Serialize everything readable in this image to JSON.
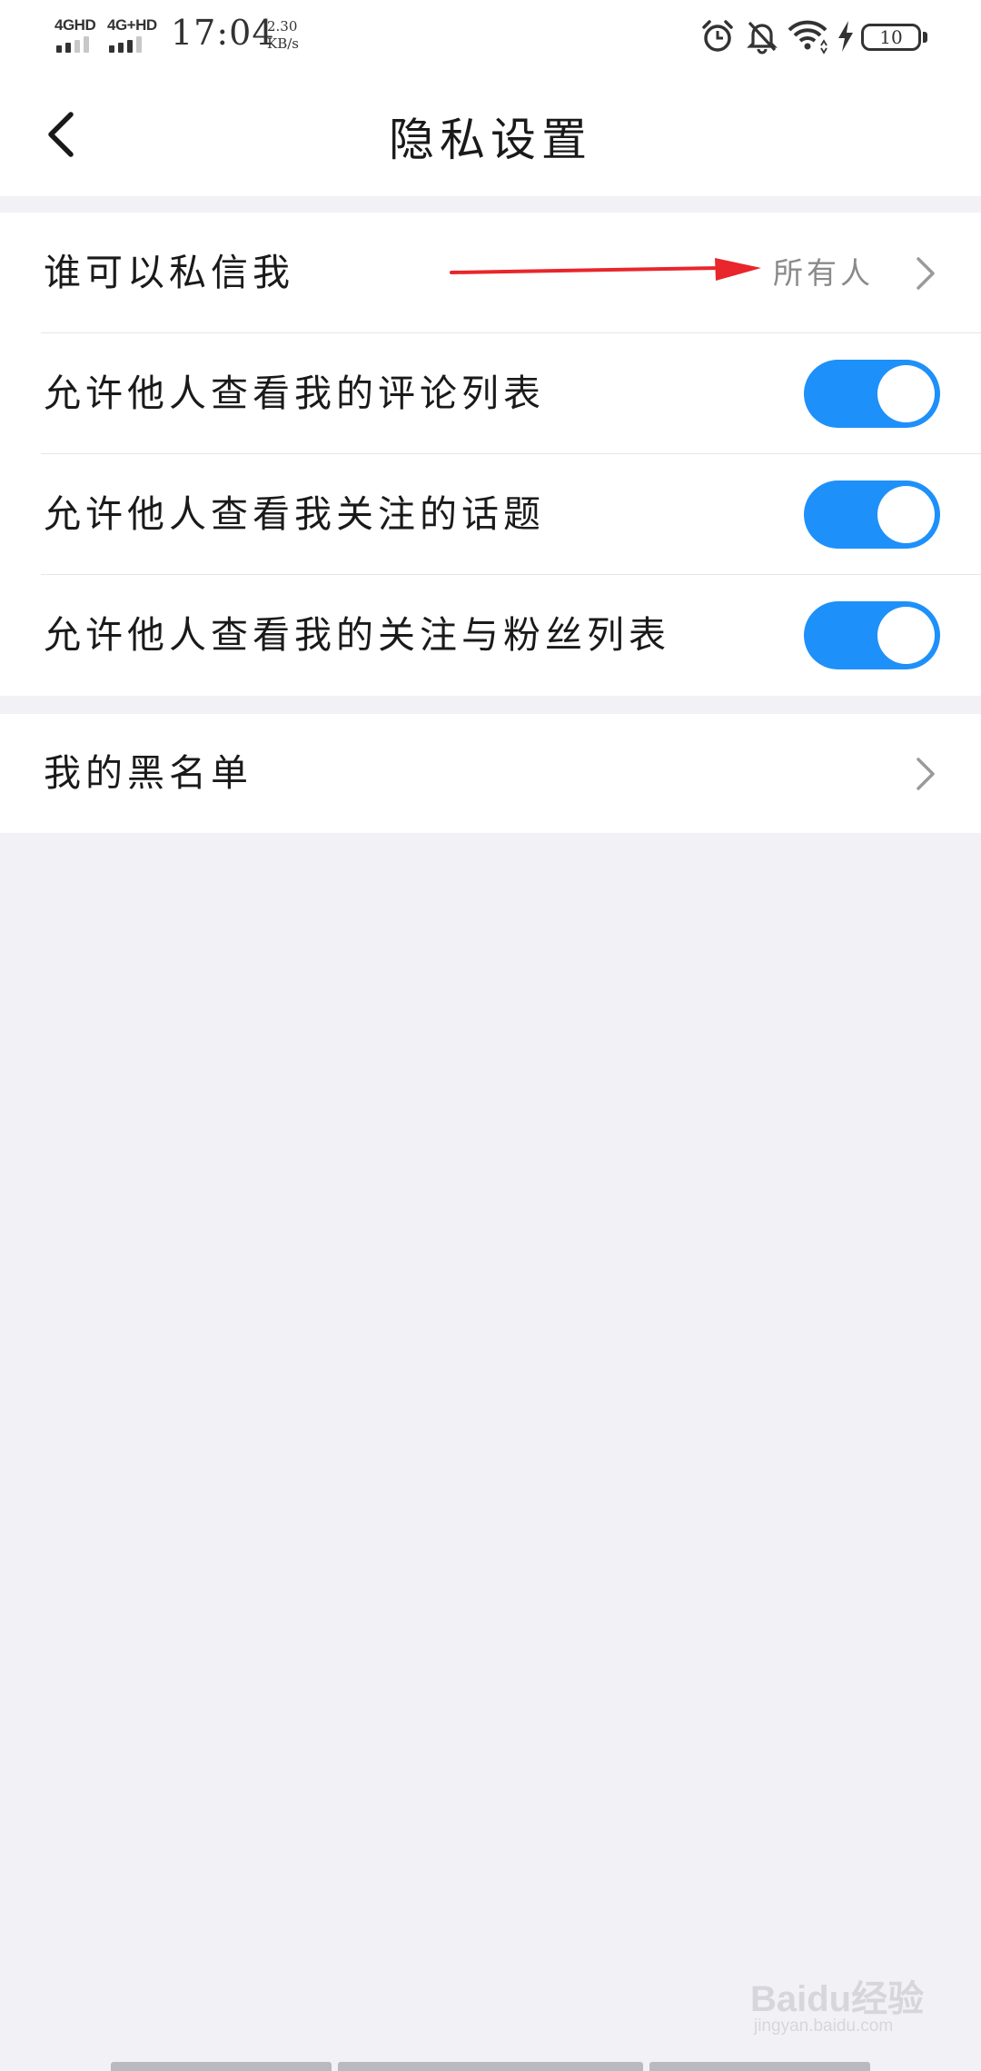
{
  "status_bar": {
    "sim1_network": "4GHD",
    "sim2_network": "4G+HD",
    "time": "17:04",
    "speed_value": "2.30",
    "speed_unit": "KB/s",
    "battery_level": "10",
    "icons": [
      "alarm-icon",
      "mute-bell-icon",
      "wifi-icon",
      "charging-icon",
      "battery-icon"
    ]
  },
  "header": {
    "title": "隐私设置",
    "back_icon": "chevron-left-icon"
  },
  "settings": {
    "who_can_message": {
      "label": "谁可以私信我",
      "value": "所有人"
    },
    "toggles": [
      {
        "label": "允许他人查看我的评论列表",
        "on": true
      },
      {
        "label": "允许他人查看我关注的话题",
        "on": true
      },
      {
        "label": "允许他人查看我的关注与粉丝列表",
        "on": true
      }
    ],
    "blacklist": {
      "label": "我的黑名单"
    }
  },
  "colors": {
    "toggle_on": "#1e90fa",
    "background": "#f1f1f6",
    "annotation_arrow": "#e8262b"
  },
  "watermark": {
    "brand": "Baidu经验",
    "site": "jingyan.baidu.com"
  }
}
